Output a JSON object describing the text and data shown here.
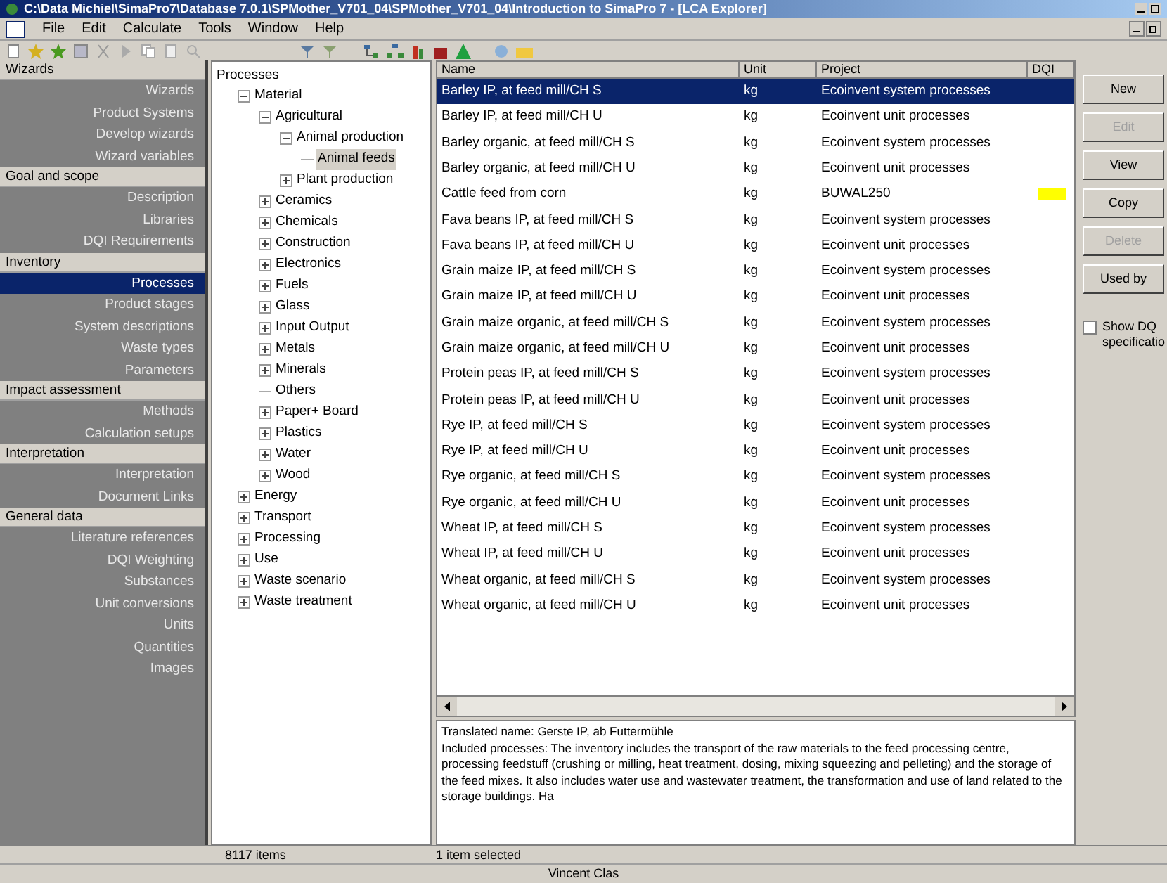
{
  "window": {
    "title": "C:\\Data Michiel\\SimaPro7\\Database 7.0.1\\SPMother_V701_04\\SPMother_V701_04\\Introduction to SimaPro 7 - [LCA Explorer]"
  },
  "menu": [
    "File",
    "Edit",
    "Calculate",
    "Tools",
    "Window",
    "Help"
  ],
  "sidebar": [
    {
      "label": "Wizards",
      "items": [
        {
          "label": "Wizards",
          "selected": false
        },
        {
          "label": "Product Systems",
          "selected": false
        },
        {
          "label": "Develop wizards",
          "selected": false
        },
        {
          "label": "Wizard variables",
          "selected": false
        }
      ]
    },
    {
      "label": "Goal and scope",
      "items": [
        {
          "label": "Description",
          "selected": false
        },
        {
          "label": "Libraries",
          "selected": false
        },
        {
          "label": "DQI Requirements",
          "selected": false
        }
      ]
    },
    {
      "label": "Inventory",
      "items": [
        {
          "label": "Processes",
          "selected": true
        },
        {
          "label": "Product stages",
          "selected": false
        },
        {
          "label": "System descriptions",
          "selected": false
        },
        {
          "label": "Waste types",
          "selected": false
        },
        {
          "label": "Parameters",
          "selected": false
        }
      ]
    },
    {
      "label": "Impact assessment",
      "items": [
        {
          "label": "Methods",
          "selected": false
        },
        {
          "label": "Calculation setups",
          "selected": false
        }
      ]
    },
    {
      "label": "Interpretation",
      "items": [
        {
          "label": "Interpretation",
          "selected": false
        },
        {
          "label": "Document Links",
          "selected": false
        }
      ]
    },
    {
      "label": "General data",
      "items": [
        {
          "label": "Literature references",
          "selected": false
        },
        {
          "label": "DQI Weighting",
          "selected": false
        },
        {
          "label": "Substances",
          "selected": false
        },
        {
          "label": "Unit conversions",
          "selected": false
        },
        {
          "label": "Units",
          "selected": false
        },
        {
          "label": "Quantities",
          "selected": false
        },
        {
          "label": "Images",
          "selected": false
        }
      ]
    }
  ],
  "tree": {
    "label": "Processes",
    "children": [
      {
        "label": "Material",
        "expanded": true,
        "selected": false,
        "children": [
          {
            "label": "Agricultural",
            "expanded": true,
            "selected": false,
            "children": [
              {
                "label": "Animal production",
                "expanded": true,
                "selected": false,
                "children": [
                  {
                    "label": "Animal feeds",
                    "selected": true
                  }
                ]
              },
              {
                "label": "Plant production",
                "expanded": false,
                "selected": false
              }
            ]
          },
          {
            "label": "Ceramics",
            "expanded": false,
            "selected": false
          },
          {
            "label": "Chemicals",
            "expanded": false,
            "selected": false
          },
          {
            "label": "Construction",
            "expanded": false,
            "selected": false
          },
          {
            "label": "Electronics",
            "expanded": false,
            "selected": false
          },
          {
            "label": "Fuels",
            "expanded": false,
            "selected": false
          },
          {
            "label": "Glass",
            "expanded": false,
            "selected": false
          },
          {
            "label": "Input Output",
            "expanded": false,
            "selected": false
          },
          {
            "label": "Metals",
            "expanded": false,
            "selected": false
          },
          {
            "label": "Minerals",
            "expanded": false,
            "selected": false
          },
          {
            "label": "Others",
            "selected": false
          },
          {
            "label": "Paper+ Board",
            "expanded": false,
            "selected": false
          },
          {
            "label": "Plastics",
            "expanded": false,
            "selected": false
          },
          {
            "label": "Water",
            "expanded": false,
            "selected": false
          },
          {
            "label": "Wood",
            "expanded": false,
            "selected": false
          }
        ]
      },
      {
        "label": "Energy",
        "expanded": false,
        "selected": false
      },
      {
        "label": "Transport",
        "expanded": false,
        "selected": false
      },
      {
        "label": "Processing",
        "expanded": false,
        "selected": false
      },
      {
        "label": "Use",
        "expanded": false,
        "selected": false
      },
      {
        "label": "Waste scenario",
        "expanded": false,
        "selected": false
      },
      {
        "label": "Waste treatment",
        "expanded": false,
        "selected": false
      }
    ]
  },
  "table": {
    "columns": [
      "Name",
      "Unit",
      "Project",
      "DQI"
    ],
    "rows": [
      {
        "name": "Barley IP, at feed mill/CH S",
        "unit": "kg",
        "project": "Ecoinvent system processes",
        "selected": true
      },
      {
        "name": "Barley IP, at feed mill/CH U",
        "unit": "kg",
        "project": "Ecoinvent unit processes",
        "selected": false
      },
      {
        "name": "Barley organic, at feed mill/CH S",
        "unit": "kg",
        "project": "Ecoinvent system processes",
        "selected": false
      },
      {
        "name": "Barley organic, at feed mill/CH U",
        "unit": "kg",
        "project": "Ecoinvent unit processes",
        "selected": false
      },
      {
        "name": "Cattle feed from corn",
        "unit": "kg",
        "project": "BUWAL250",
        "selected": false,
        "color": "#ffff00"
      },
      {
        "name": "Fava beans IP, at feed mill/CH S",
        "unit": "kg",
        "project": "Ecoinvent system processes",
        "selected": false
      },
      {
        "name": "Fava beans IP, at feed mill/CH U",
        "unit": "kg",
        "project": "Ecoinvent unit processes",
        "selected": false
      },
      {
        "name": "Grain maize IP, at feed mill/CH S",
        "unit": "kg",
        "project": "Ecoinvent system processes",
        "selected": false
      },
      {
        "name": "Grain maize IP, at feed mill/CH U",
        "unit": "kg",
        "project": "Ecoinvent unit processes",
        "selected": false
      },
      {
        "name": "Grain maize organic, at feed mill/CH S",
        "unit": "kg",
        "project": "Ecoinvent system processes",
        "selected": false
      },
      {
        "name": "Grain maize organic, at feed mill/CH U",
        "unit": "kg",
        "project": "Ecoinvent unit processes",
        "selected": false
      },
      {
        "name": "Protein peas IP, at feed mill/CH S",
        "unit": "kg",
        "project": "Ecoinvent system processes",
        "selected": false
      },
      {
        "name": "Protein peas IP, at feed mill/CH U",
        "unit": "kg",
        "project": "Ecoinvent unit processes",
        "selected": false
      },
      {
        "name": "Rye IP, at feed mill/CH S",
        "unit": "kg",
        "project": "Ecoinvent system processes",
        "selected": false
      },
      {
        "name": "Rye IP, at feed mill/CH U",
        "unit": "kg",
        "project": "Ecoinvent unit processes",
        "selected": false
      },
      {
        "name": "Rye organic, at feed mill/CH S",
        "unit": "kg",
        "project": "Ecoinvent system processes",
        "selected": false
      },
      {
        "name": "Rye organic, at feed mill/CH U",
        "unit": "kg",
        "project": "Ecoinvent unit processes",
        "selected": false
      },
      {
        "name": "Wheat IP, at feed mill/CH S",
        "unit": "kg",
        "project": "Ecoinvent system processes",
        "selected": false
      },
      {
        "name": "Wheat IP, at feed mill/CH U",
        "unit": "kg",
        "project": "Ecoinvent unit processes",
        "selected": false
      },
      {
        "name": "Wheat organic, at feed mill/CH S",
        "unit": "kg",
        "project": "Ecoinvent system processes",
        "selected": false
      },
      {
        "name": "Wheat organic, at feed mill/CH U",
        "unit": "kg",
        "project": "Ecoinvent unit processes",
        "selected": false
      }
    ]
  },
  "description": [
    "Translated name: Gerste IP, ab Futtermühle",
    "Included processes: The inventory includes the transport of the raw materials to the feed processing centre, processing feedstuff (crushing or milling, heat treatment, dosing, mixing squeezing and pelleting) and the storage of the feed mixes. It also includes water use and wastewater treatment, the transformation and use of land related to the storage buildings. Ha"
  ],
  "buttons": [
    {
      "label": "New",
      "disabled": false
    },
    {
      "label": "Edit",
      "disabled": true
    },
    {
      "label": "View",
      "disabled": false
    },
    {
      "label": "Copy",
      "disabled": false
    },
    {
      "label": "Delete",
      "disabled": true
    },
    {
      "label": "Used by",
      "disabled": false
    }
  ],
  "show_dqi": {
    "label_lines": [
      "Show DQ",
      "specificatio"
    ],
    "checked": false
  },
  "status_bar": [
    "8117 items",
    "1 item selected"
  ],
  "footer": "Vincent Clas"
}
